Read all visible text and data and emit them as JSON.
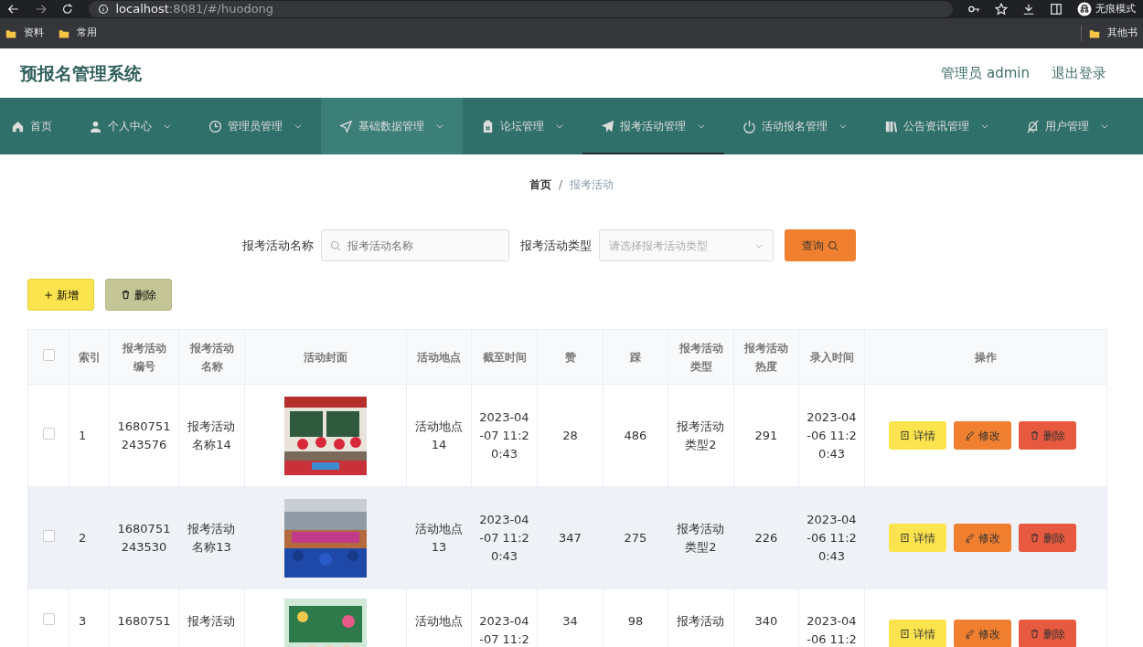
{
  "browser": {
    "url_host": "localhost",
    "url_rest": ":8081/#/huodong",
    "incognito_label": "无痕模式",
    "bookmarks": [
      "资料",
      "常用"
    ],
    "other_bookmarks": "其他书"
  },
  "header": {
    "title": "预报名管理系统",
    "user": "管理员 admin",
    "logout": "退出登录"
  },
  "nav": [
    {
      "label": "首页",
      "dropdown": false,
      "selected": false,
      "highlighted": false
    },
    {
      "label": "个人中心",
      "dropdown": true,
      "selected": false,
      "highlighted": false
    },
    {
      "label": "管理员管理",
      "dropdown": true,
      "selected": false,
      "highlighted": false
    },
    {
      "label": "基础数据管理",
      "dropdown": true,
      "selected": false,
      "highlighted": true
    },
    {
      "label": "论坛管理",
      "dropdown": true,
      "selected": false,
      "highlighted": false
    },
    {
      "label": "报考活动管理",
      "dropdown": true,
      "selected": true,
      "highlighted": false
    },
    {
      "label": "活动报名管理",
      "dropdown": true,
      "selected": false,
      "highlighted": false
    },
    {
      "label": "公告资讯管理",
      "dropdown": true,
      "selected": false,
      "highlighted": false
    },
    {
      "label": "用户管理",
      "dropdown": true,
      "selected": false,
      "highlighted": false
    }
  ],
  "breadcrumb": [
    "首页",
    "报考活动"
  ],
  "breadcrumb_separator": "/",
  "search": {
    "name_label": "报考活动名称",
    "name_placeholder": "报考活动名称",
    "type_label": "报考活动类型",
    "type_placeholder": "请选择报考活动类型",
    "query_button": "查询"
  },
  "actions": {
    "add": "新增",
    "delete": "删除"
  },
  "table": {
    "all_checked": false,
    "columns": [
      "索引",
      "报考活动编号",
      "报考活动名称",
      "活动封面",
      "活动地点",
      "截至时间",
      "赞",
      "踩",
      "报考活动类型",
      "报考活动热度",
      "录入时间",
      "操作"
    ],
    "rows": [
      {
        "checked": false,
        "highlighted": false,
        "actions": [
          "详情",
          "修改",
          "删除"
        ],
        "cells": [
          "1",
          "1680751243576",
          "报考活动名称14",
          {
            "kind": "picture"
          },
          "活动地点14",
          "2023-04-07 11:20:43",
          "28",
          "486",
          "报考活动类型2",
          "291",
          "2023-04-06 11:20:43"
        ]
      },
      {
        "checked": false,
        "highlighted": true,
        "actions": [
          "详情",
          "修改",
          "删除"
        ],
        "cells": [
          "2",
          "1680751243530",
          "报考活动名称13",
          {
            "kind": "picture"
          },
          "活动地点13",
          "2023-04-07 11:20:43",
          "347",
          "275",
          "报考活动类型2",
          "226",
          "2023-04-06 11:20:43"
        ]
      },
      {
        "checked": false,
        "highlighted": false,
        "actions": [
          "详情",
          "修改",
          "删除"
        ],
        "cells": [
          "3",
          "1680751",
          "报考活动",
          {
            "kind": "picture"
          },
          "活动地点",
          "2023-04-07 11:2",
          "34",
          "98",
          "报考活动",
          "340",
          "2023-04-06 11:2"
        ]
      }
    ]
  }
}
